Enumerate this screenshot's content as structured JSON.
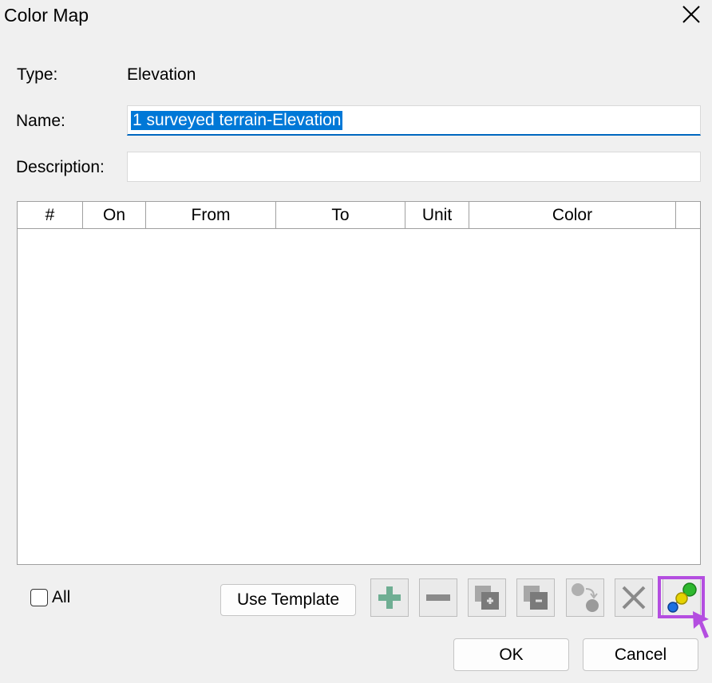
{
  "window": {
    "title": "Color Map"
  },
  "form": {
    "type_label": "Type:",
    "type_value": "Elevation",
    "name_label": "Name:",
    "name_value": "1 surveyed terrain-Elevation",
    "description_label": "Description:",
    "description_value": ""
  },
  "table": {
    "columns": [
      "#",
      "On",
      "From",
      "To",
      "Unit",
      "Color"
    ],
    "rows": []
  },
  "controls": {
    "all_label": "All",
    "all_checked": false,
    "use_template_label": "Use Template",
    "ok_label": "OK",
    "cancel_label": "Cancel"
  },
  "toolbar": [
    {
      "icon": "add-row-icon",
      "enabled": true
    },
    {
      "icon": "remove-row-icon",
      "enabled": false
    },
    {
      "icon": "insert-above-icon",
      "enabled": false
    },
    {
      "icon": "insert-below-icon",
      "enabled": false
    },
    {
      "icon": "reorder-icon",
      "enabled": false
    },
    {
      "icon": "delete-icon",
      "enabled": false
    },
    {
      "icon": "color-ramp-icon",
      "enabled": true,
      "highlighted": true
    }
  ],
  "colors": {
    "highlight": "#b44ee0",
    "selection": "#0078d7",
    "focus_underline": "#0067c0",
    "add_icon": "#6fae93"
  }
}
